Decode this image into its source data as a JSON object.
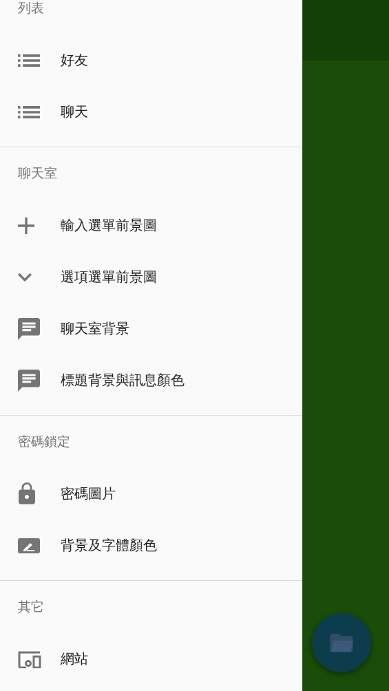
{
  "drawer": {
    "sections": [
      {
        "header": "列表",
        "items": [
          {
            "label": "好友"
          },
          {
            "label": "聊天"
          }
        ]
      },
      {
        "header": "聊天室",
        "items": [
          {
            "label": "輸入選單前景圖"
          },
          {
            "label": "選項選單前景圖"
          },
          {
            "label": "聊天室背景"
          },
          {
            "label": "標題背景與訊息顏色"
          }
        ]
      },
      {
        "header": "密碼鎖定",
        "items": [
          {
            "label": "密碼圖片"
          },
          {
            "label": "背景及字體顏色"
          }
        ]
      },
      {
        "header": "其它",
        "items": [
          {
            "label": "網站"
          }
        ]
      }
    ]
  }
}
